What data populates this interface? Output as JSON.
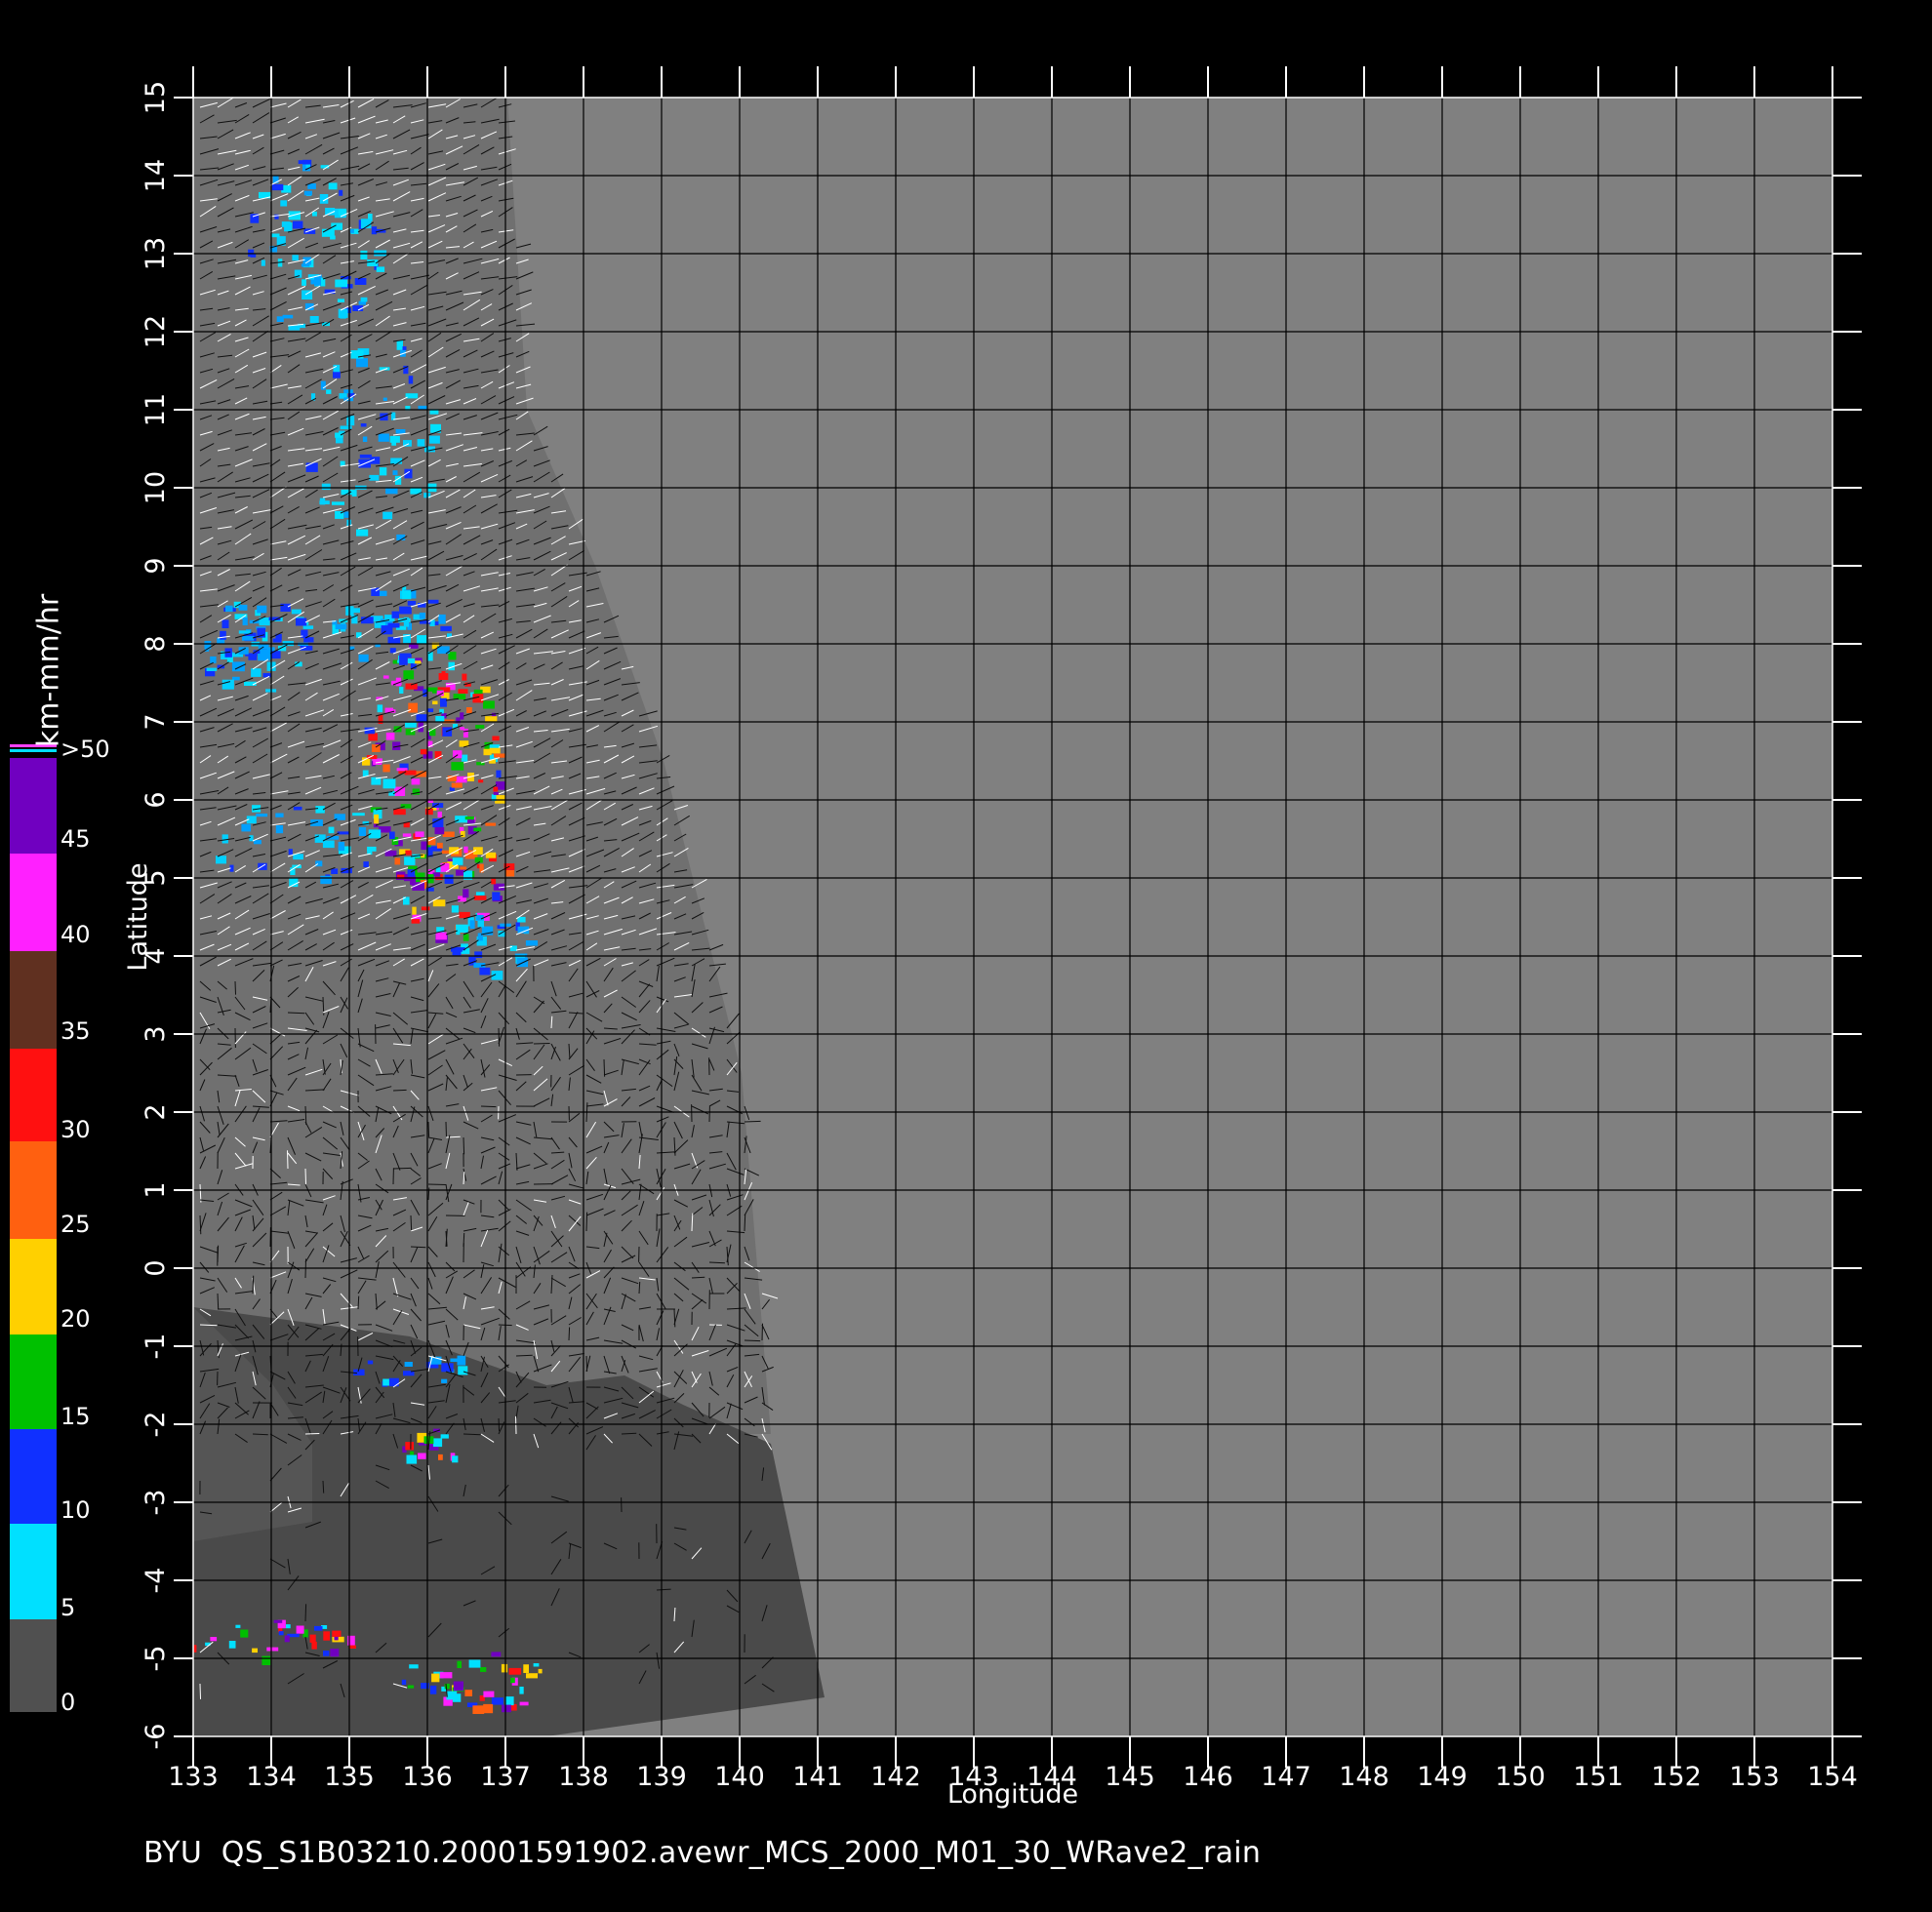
{
  "map": {
    "x_axis": {
      "title": "Longitude",
      "ticks": [
        "133",
        "134",
        "135",
        "136",
        "137",
        "138",
        "139",
        "140",
        "141",
        "142",
        "143",
        "144",
        "145",
        "146",
        "147",
        "148",
        "149",
        "150",
        "151",
        "152",
        "153",
        "154"
      ]
    },
    "y_axis": {
      "title": "Latitude",
      "ticks": [
        "15",
        "14",
        "13",
        "12",
        "11",
        "10",
        "9",
        "8",
        "7",
        "6",
        "5",
        "4",
        "3",
        "2",
        "1",
        "0",
        "-1",
        "-2",
        "-3",
        "-4",
        "-5",
        "-6"
      ]
    },
    "background_color": "#808080",
    "land_color": "#4a4a4a"
  },
  "colorbar": {
    "title": "km-mm/hr",
    "labels": [
      ">50",
      "45",
      "40",
      "35",
      "30",
      "25",
      "20",
      "15",
      "10",
      "5",
      "0"
    ],
    "colors": [
      "#7000c0",
      "#d000e0",
      "#ff20ff",
      "#603020",
      "#c07050",
      "#ff1010",
      "#ff6010",
      "#ffd000",
      "#00c000",
      "#1030ff",
      "#00e0ff",
      "#505050"
    ]
  },
  "footer": {
    "caption": "BYU  QS_S1B03210.20001591902.avewr_MCS_2000_M01_30_WRave2_rain"
  }
}
